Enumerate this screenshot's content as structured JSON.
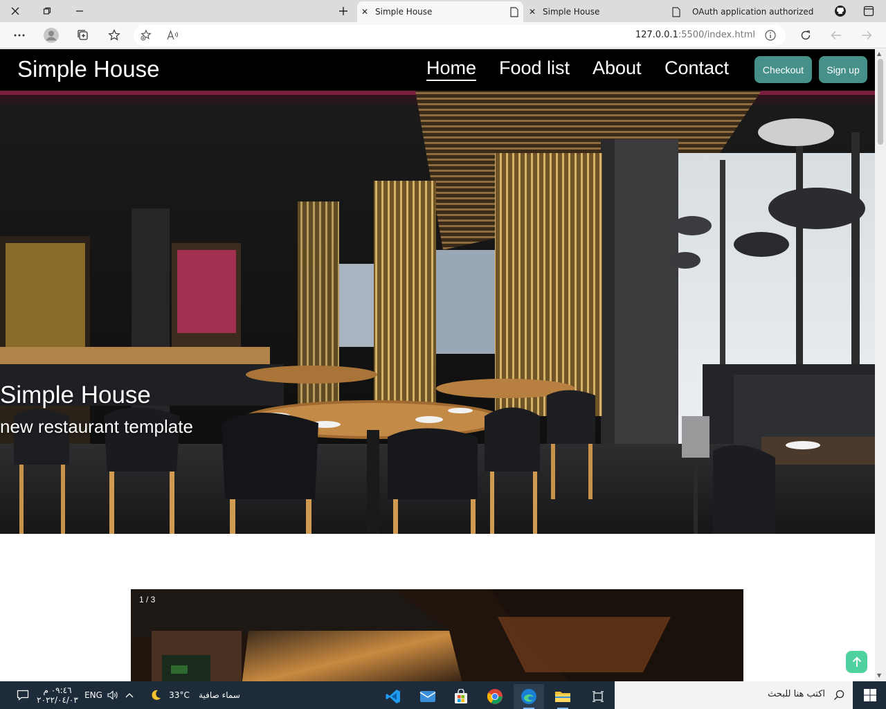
{
  "browser": {
    "tabs": [
      {
        "label": "Simple House",
        "active": true
      },
      {
        "label": "Simple House",
        "active": false
      },
      {
        "label": "OAuth application authorized",
        "active": false
      }
    ],
    "url_host": "127.0.0.1",
    "url_rest": ":5500/index.html"
  },
  "site": {
    "brand": "Simple House",
    "nav": [
      "Home",
      "Food list",
      "About",
      "Contact"
    ],
    "checkout_label": "Checkout",
    "signup_label": "Sign up"
  },
  "hero": {
    "title": "Simple House",
    "subtitle": "new restaurant template"
  },
  "carousel": {
    "counter": "1 / 3"
  },
  "taskbar": {
    "search_placeholder": "اكتب هنا للبحث",
    "weather_temp": "33°C",
    "weather_desc": "سماء صافية",
    "language": "ENG",
    "time": "٠٩:٤٦ م",
    "date": "٢٠٢٢/٠٤/٠٣"
  },
  "colors": {
    "accent_teal": "#46908a",
    "to_top": "#4fd1a0",
    "nav_bg": "#000000",
    "taskbar_bg": "#1d2b3a"
  }
}
